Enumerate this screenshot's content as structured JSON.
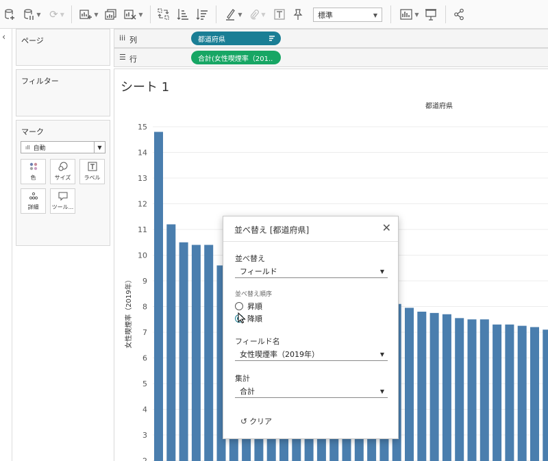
{
  "toolbar": {
    "format_select": "標準",
    "icons": [
      "new-data-source-icon",
      "pause-updates-icon",
      "refresh-icon",
      "new-worksheet-icon",
      "duplicate-sheet-icon",
      "clear-sheet-icon",
      "swap-rows-columns-icon",
      "sort-ascending-icon",
      "sort-descending-icon",
      "highlight-icon",
      "group-icon",
      "show-labels-icon",
      "pin-axes-icon",
      "show-me-icon",
      "presentation-icon",
      "share-icon"
    ]
  },
  "cards": {
    "pages_title": "ページ",
    "filters_title": "フィルター",
    "marks_title": "マーク",
    "marks_type": "自動",
    "mark_buttons": {
      "color": "色",
      "size": "サイズ",
      "label": "ラベル",
      "detail": "詳細",
      "tooltip": "ツール..."
    }
  },
  "shelves": {
    "columns_label": "列",
    "columns_pill": "都道府県",
    "rows_label": "行",
    "rows_pill": "合計(女性喫煙率（201.."
  },
  "view": {
    "sheet_title": "シート 1"
  },
  "chart_data": {
    "type": "bar",
    "column_header": "都道府県",
    "ylabel": "女性喫煙率（2019年）",
    "ylim": [
      2,
      15
    ],
    "yticks": [
      2,
      3,
      4,
      5,
      6,
      7,
      8,
      9,
      10,
      11,
      12,
      13,
      14,
      15
    ],
    "grid": true,
    "bar_color": "#4a7eae",
    "values": [
      14.8,
      11.2,
      10.5,
      10.4,
      10.4,
      9.6,
      9.4,
      9.3,
      9.2,
      9.1,
      9.0,
      8.9,
      8.8,
      8.7,
      8.6,
      8.5,
      8.4,
      8.3,
      8.2,
      8.1,
      7.95,
      7.8,
      7.75,
      7.7,
      7.55,
      7.5,
      7.5,
      7.3,
      7.3,
      7.25,
      7.2,
      7.1
    ]
  },
  "dialog": {
    "title": "並べ替え [都道府県]",
    "sort_by_label": "並べ替え",
    "sort_by_value": "フィールド",
    "sort_order_label": "並べ替え順序",
    "ascending_label": "昇順",
    "descending_label": "降順",
    "selected_order": "descending",
    "field_name_label": "フィールド名",
    "field_name_value": "女性喫煙率（2019年）",
    "aggregation_label": "集計",
    "aggregation_value": "合計",
    "clear_label": "クリア"
  }
}
